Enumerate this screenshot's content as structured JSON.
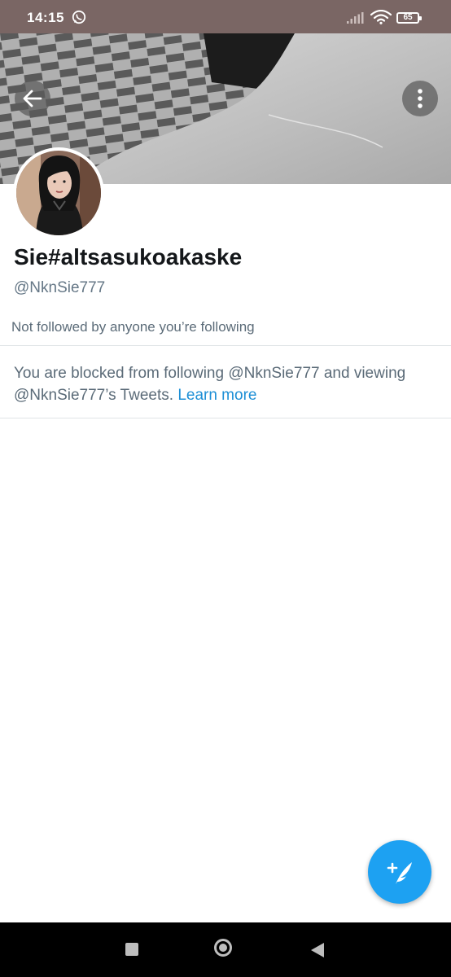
{
  "status_bar": {
    "time": "14:15",
    "battery": "65",
    "icons": [
      "whatsapp-icon",
      "signal-icon",
      "wifi-icon",
      "battery-icon"
    ]
  },
  "header": {
    "back_icon": "arrow-left-icon",
    "more_icon": "more-vertical-icon"
  },
  "profile": {
    "display_name": "Sie#altsasukoakaske",
    "handle": "@NknSie777",
    "followers_note": "Not followed by anyone you’re following"
  },
  "blocked_notice": {
    "text": "You are blocked from following @NknSie777 and viewing @NknSie777’s Tweets.",
    "link_label": "Learn more"
  },
  "fab": {
    "icon": "compose-tweet-icon"
  },
  "nav_bar": {
    "icons": [
      "recents-square-icon",
      "home-circle-icon",
      "back-triangle-icon"
    ]
  },
  "colors": {
    "accent": "#1da1f2",
    "link": "#1d8fd6",
    "status_bar_bg": "#7a6664",
    "secondary_text": "#5b6b78"
  }
}
